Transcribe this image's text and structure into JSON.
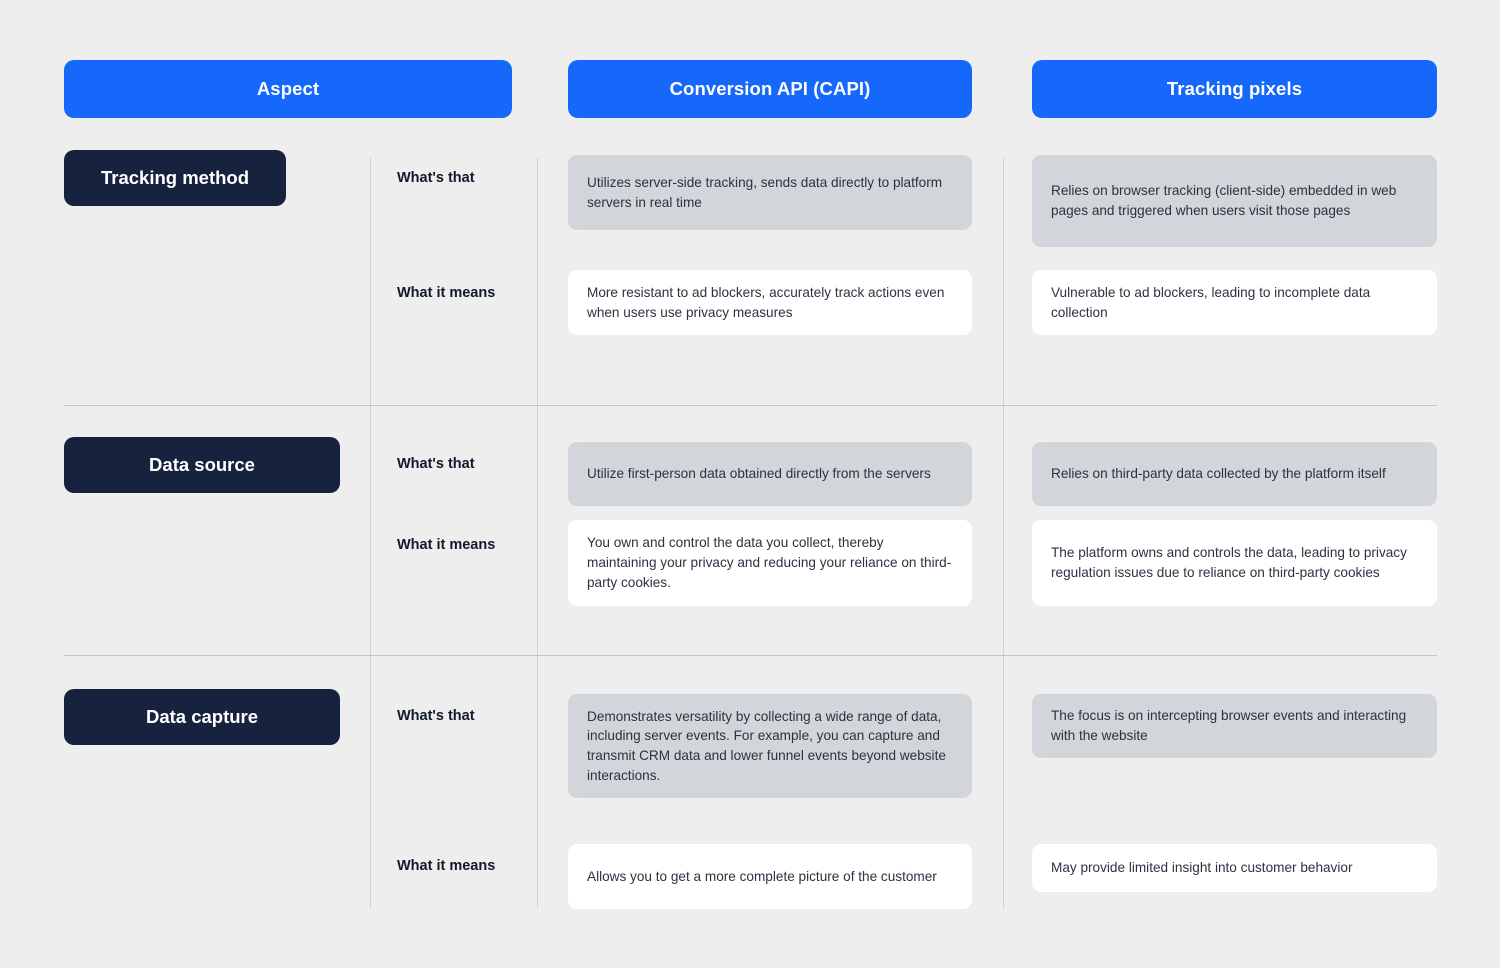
{
  "theme": {
    "background": "#eeeeee",
    "header_blue": "#1668fa",
    "label_navy": "#17223f",
    "card_gray": "#d2d5da",
    "card_white": "#ffffff",
    "divider": "#c6c6c6",
    "body_text": "#2b3240"
  },
  "headers": {
    "aspect": "Aspect",
    "capi": "Conversion API (CAPI)",
    "pixels": "Tracking pixels"
  },
  "sub_labels": {
    "whats_that": "What's that",
    "what_it_means": "What it means"
  },
  "rows": [
    {
      "aspect": "Tracking method",
      "capi": {
        "whats_that": "Utilizes server-side tracking, sends data directly to platform servers in real time",
        "what_it_means": "More resistant to ad blockers, accurately track actions even when users use privacy measures"
      },
      "pixels": {
        "whats_that": "Relies on browser tracking (client-side) embedded in web pages and triggered when users visit those pages",
        "what_it_means": "Vulnerable to ad blockers, leading to incomplete data collection"
      }
    },
    {
      "aspect": "Data source",
      "capi": {
        "whats_that": "Utilize first-person data obtained directly from the servers",
        "what_it_means": "You own and control the data you collect, thereby maintaining your privacy and reducing your reliance on third-party cookies."
      },
      "pixels": {
        "whats_that": "Relies on third-party data collected by the platform itself",
        "what_it_means": "The platform owns and controls the data, leading to privacy regulation issues due to reliance on third-party cookies"
      }
    },
    {
      "aspect": "Data capture",
      "capi": {
        "whats_that": "Demonstrates versatility by collecting a wide range of data, including server events. For example, you can capture and transmit CRM data and lower funnel events beyond website interactions.",
        "what_it_means": "Allows you to get a more complete picture of the customer"
      },
      "pixels": {
        "whats_that": "The focus is on intercepting browser events and interacting with the website",
        "what_it_means": "May provide limited insight into customer behavior"
      }
    }
  ]
}
